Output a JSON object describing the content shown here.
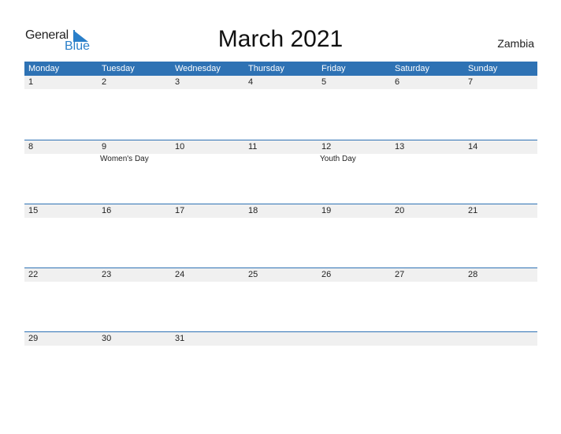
{
  "logo": {
    "general": "General",
    "blue": "Blue"
  },
  "title": "March 2021",
  "country": "Zambia",
  "weekdays": [
    "Monday",
    "Tuesday",
    "Wednesday",
    "Thursday",
    "Friday",
    "Saturday",
    "Sunday"
  ],
  "weeks": [
    {
      "dates": [
        "1",
        "2",
        "3",
        "4",
        "5",
        "6",
        "7"
      ],
      "events": [
        "",
        "",
        "",
        "",
        "",
        "",
        ""
      ]
    },
    {
      "dates": [
        "8",
        "9",
        "10",
        "11",
        "12",
        "13",
        "14"
      ],
      "events": [
        "",
        "Women's Day",
        "",
        "",
        "Youth Day",
        "",
        ""
      ]
    },
    {
      "dates": [
        "15",
        "16",
        "17",
        "18",
        "19",
        "20",
        "21"
      ],
      "events": [
        "",
        "",
        "",
        "",
        "",
        "",
        ""
      ]
    },
    {
      "dates": [
        "22",
        "23",
        "24",
        "25",
        "26",
        "27",
        "28"
      ],
      "events": [
        "",
        "",
        "",
        "",
        "",
        "",
        ""
      ]
    },
    {
      "dates": [
        "29",
        "30",
        "31",
        "",
        "",
        "",
        ""
      ],
      "events": [
        "",
        "",
        "",
        "",
        "",
        "",
        ""
      ]
    }
  ],
  "colors": {
    "header": "#2e72b4",
    "date_strip": "#f0f0f0",
    "logo_blue": "#2a7fc9"
  }
}
